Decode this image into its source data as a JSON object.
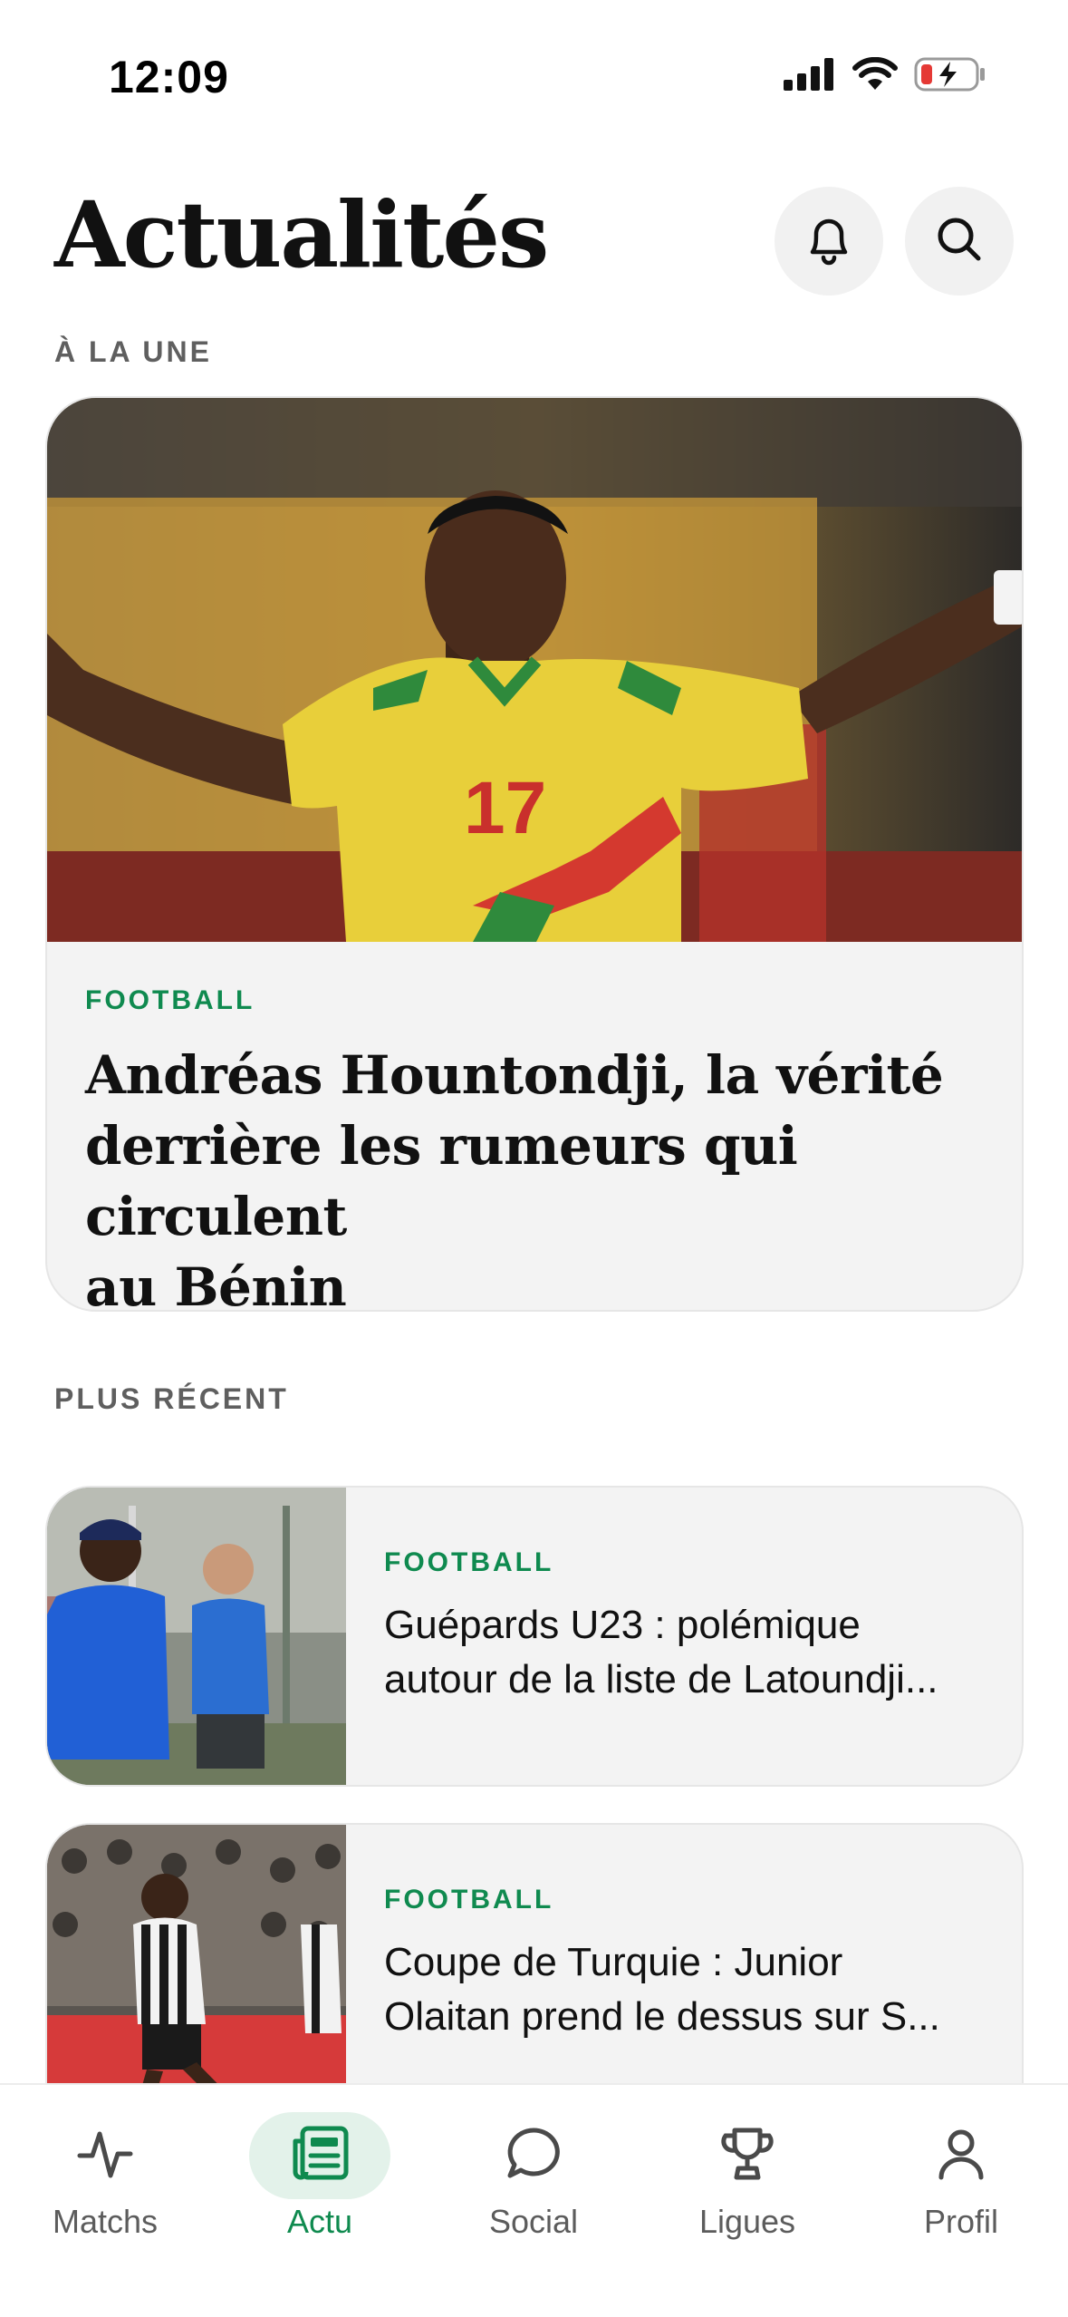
{
  "status_bar": {
    "time": "12:09",
    "icons": [
      "cellular-signal-icon",
      "wifi-icon",
      "battery-charging-icon"
    ]
  },
  "header": {
    "title": "Actualités",
    "actions": [
      "bell-icon",
      "search-icon"
    ]
  },
  "featured": {
    "section_label": "À LA UNE",
    "category": "FOOTBALL",
    "title_lines": [
      "Andréas Hountondji, la vérité",
      "derrière les rumeurs qui circulent",
      "au Bénin"
    ],
    "image_jersey_number": "17"
  },
  "recent": {
    "section_label": "PLUS RÉCENT",
    "articles": [
      {
        "category": "FOOTBALL",
        "title_lines": [
          "Guépards U23 : polémique",
          "autour de la liste de Latoundji..."
        ]
      },
      {
        "category": "FOOTBALL",
        "title_lines": [
          "Coupe de Turquie : Junior",
          "Olaitan prend le dessus sur S..."
        ]
      }
    ]
  },
  "tab_bar": {
    "tabs": [
      {
        "label": "Matchs",
        "icon": "activity-icon",
        "active": false
      },
      {
        "label": "Actu",
        "icon": "newspaper-icon",
        "active": true
      },
      {
        "label": "Social",
        "icon": "chat-bubble-icon",
        "active": false
      },
      {
        "label": "Ligues",
        "icon": "trophy-icon",
        "active": false
      },
      {
        "label": "Profil",
        "icon": "user-icon",
        "active": false
      }
    ]
  },
  "colors": {
    "accent": "#0f8a4f",
    "accent_tint": "#e3f2ea",
    "card_bg": "#f3f3f3",
    "muted_text": "#5f5f5f"
  }
}
